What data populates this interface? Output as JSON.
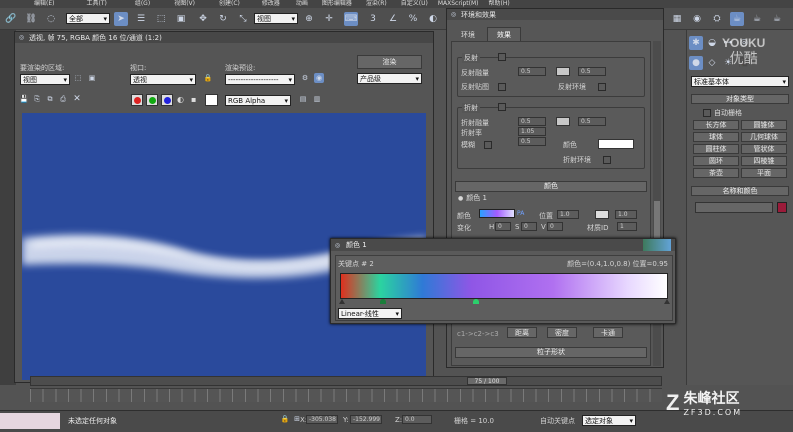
{
  "menubar": {
    "items": [
      "编辑(E)",
      "工具(T)",
      "组(G)",
      "视图(V)",
      "创建(C)",
      "修改器",
      "动画",
      "图形编辑器",
      "渲染(R)",
      "自定义(U)",
      "MAXScript(M)",
      "帮助(H)"
    ]
  },
  "toolbar": {
    "filter_select": "全部",
    "view_select": "视图"
  },
  "render_window": {
    "title": "透视, 帧 75, RGBA 颜色 16 位/通道 (1:2)",
    "area_label": "要渲染的区域:",
    "area_value": "视图",
    "viewport_label": "视口:",
    "viewport_value": "透视",
    "preset_label": "渲染预设:",
    "preset_value": "--------------------",
    "render_button": "渲染",
    "product_value": "产品级",
    "channel_value": "RGB Alpha"
  },
  "env_dialog": {
    "title": "环境和效果",
    "tabs": [
      "环境",
      "效果"
    ],
    "reflect": {
      "group": "反射",
      "amount_label": "反射融量",
      "amount1": "0.5",
      "amount2": "0.5",
      "map_label": "反射贴图",
      "env_label": "反射环境"
    },
    "refract": {
      "group": "折射",
      "amount_label": "折射融量",
      "amount1": "0.5",
      "amount2": "0.5",
      "ior_label": "折射率",
      "ior_value": "1.05",
      "ior2": "0.5",
      "blur_label": "模糊",
      "color_label": "颜色",
      "env_label": "折射环境"
    },
    "color_rollout": "颜色",
    "color1_label": "颜色 1",
    "color_row": {
      "label": "颜色",
      "pa": "PA",
      "pos_label": "位置",
      "pos_value": "1.0",
      "pos2": "1.0"
    },
    "change_row": {
      "label": "变化",
      "h": "H",
      "h_val": "0",
      "s": "S",
      "s_val": "0",
      "v": "V",
      "v_val": "0",
      "mat_label": "材质ID",
      "mat_val": "1"
    },
    "bottom_buttons": [
      "距离",
      "密度",
      "卡通"
    ],
    "bottom_left": "c1->c2->c3",
    "particle_rollout": "粒子形状"
  },
  "right_panel": {
    "dropdown": "标准基本体",
    "object_type": "对象类型",
    "auto_grid": "自动栅格",
    "buttons": [
      "长方体",
      "圆锥体",
      "球体",
      "几何球体",
      "圆柱体",
      "管状体",
      "圆环",
      "四棱锥",
      "茶壶",
      "平面"
    ],
    "name_color": "名称和颜色",
    "object_color": "#9b1b3a"
  },
  "color_dialog": {
    "title": "颜色 1",
    "key_label": "关键点 # 2",
    "color_info": "颜色=(0.4,1.0,0.8) 位置=0.95",
    "interp_value": "Linear-线性"
  },
  "timeline": {
    "frame": "75 / 100"
  },
  "status": {
    "selection": "未选定任何对象",
    "x_label": "X:",
    "x_value": "-305.038",
    "y_label": "Y:",
    "y_value": "-152.999",
    "z_label": "Z:",
    "z_value": "0.0",
    "grid": "栅格 = 10.0",
    "auto_key": "自动关键点",
    "select_obj": "选定对象"
  },
  "watermarks": {
    "youku": "YOUKU",
    "youku_cn": "优酷",
    "site": "朱峰社区",
    "site_url": "ZF3D.COM"
  },
  "colors": {
    "render_bg": "#2a4a9c",
    "key1": "#1a7e3a",
    "key2": "#2bd06c"
  }
}
